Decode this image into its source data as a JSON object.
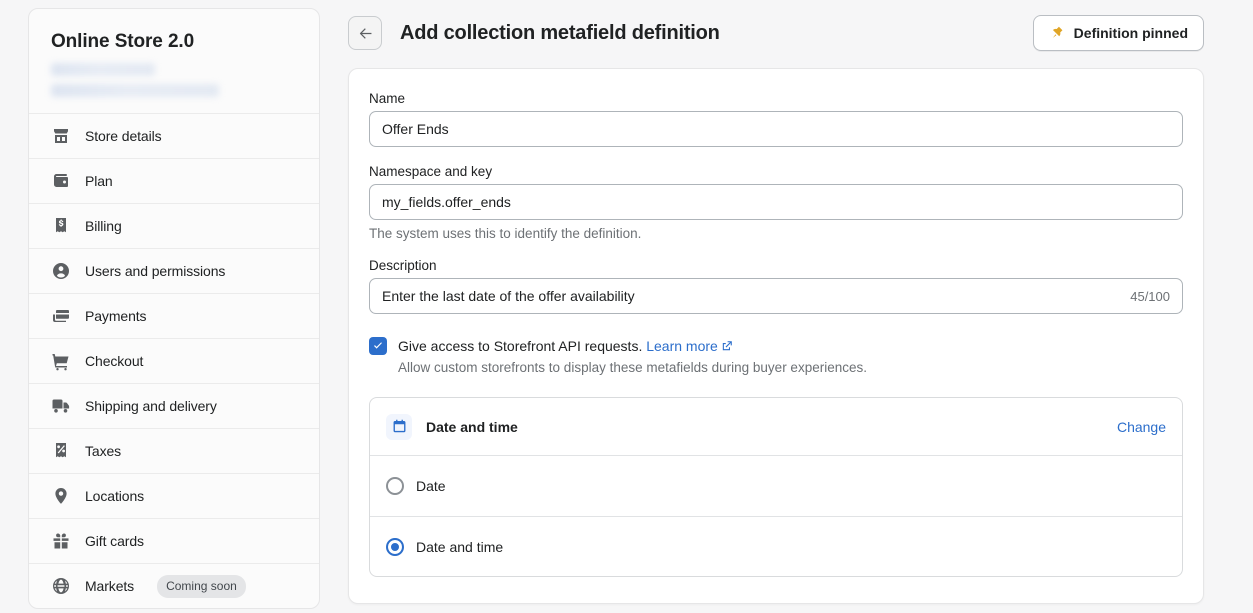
{
  "sidebar": {
    "store_title": "Online Store 2.0",
    "redacted_lines": 2,
    "items": [
      {
        "label": "Store details",
        "icon": "store-icon",
        "badge": null
      },
      {
        "label": "Plan",
        "icon": "wallet-icon",
        "badge": null
      },
      {
        "label": "Billing",
        "icon": "receipt-dollar-icon",
        "badge": null
      },
      {
        "label": "Users and permissions",
        "icon": "person-icon",
        "badge": null
      },
      {
        "label": "Payments",
        "icon": "payment-card-icon",
        "badge": null
      },
      {
        "label": "Checkout",
        "icon": "shopping-cart-icon",
        "badge": null
      },
      {
        "label": "Shipping and delivery",
        "icon": "delivery-truck-icon",
        "badge": null
      },
      {
        "label": "Taxes",
        "icon": "percent-receipt-icon",
        "badge": null
      },
      {
        "label": "Locations",
        "icon": "map-pin-icon",
        "badge": null
      },
      {
        "label": "Gift cards",
        "icon": "gift-icon",
        "badge": null
      },
      {
        "label": "Markets",
        "icon": "globe-icon",
        "badge": "Coming soon"
      }
    ]
  },
  "header": {
    "back_icon": "arrow-left-icon",
    "title": "Add collection metafield definition",
    "pin_label": "Definition pinned",
    "pin_icon": "pushpin-icon",
    "pin_icon_color": "#e0a526"
  },
  "form": {
    "name": {
      "label": "Name",
      "value": "Offer Ends"
    },
    "namespace": {
      "label": "Namespace and key",
      "value": "my_fields.offer_ends",
      "help": "The system uses this to identify the definition."
    },
    "description": {
      "label": "Description",
      "value": "Enter the last date of the offer availability",
      "counter": "45/100"
    },
    "storefront_access": {
      "checked": true,
      "label": "Give access to Storefront API requests.",
      "link_label": "Learn more",
      "link_icon": "external-link-icon",
      "sublabel": "Allow custom storefronts to display these metafields during buyer experiences."
    },
    "type": {
      "icon": "calendar-icon",
      "title": "Date and time",
      "change_label": "Change",
      "options": [
        {
          "label": "Date",
          "selected": false
        },
        {
          "label": "Date and time",
          "selected": true
        }
      ]
    }
  },
  "colors": {
    "accent": "#2c6ecb",
    "page_bg": "#f6f6f7",
    "text": "#202223",
    "muted": "#6d7175"
  }
}
